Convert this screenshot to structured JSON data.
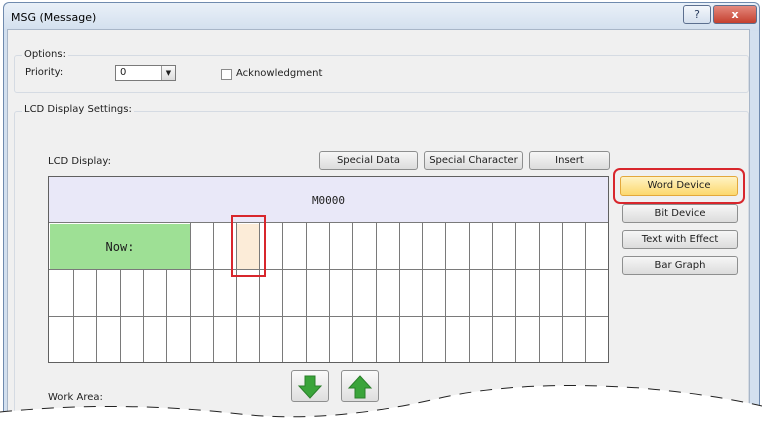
{
  "window": {
    "title": "MSG (Message)",
    "help_glyph": "?",
    "close_glyph": "x"
  },
  "options": {
    "group_label": "Options:",
    "priority_label": "Priority:",
    "priority_value": "0",
    "acknowledgment_label": "Acknowledgment",
    "acknowledgment_checked": false
  },
  "lcd": {
    "group_label": "LCD Display Settings:",
    "display_label": "LCD Display:",
    "row1_device": "M0000",
    "row2_text": "Now:",
    "columns": 24,
    "rows": 4,
    "buttons": {
      "special_data": "Special Data",
      "special_character": "Special Character",
      "insert": "Insert"
    },
    "work_area_label": "Work Area:"
  },
  "side_buttons": {
    "word_device": "Word Device",
    "bit_device": "Bit Device",
    "text_with_effect": "Text with Effect",
    "bar_graph": "Bar Graph"
  },
  "icons": {
    "down": "down-arrow-icon",
    "up": "up-arrow-icon"
  },
  "colors": {
    "highlight": "#d8262c",
    "word_device_bg": "#fcd86e",
    "lcd_header_bg": "#e9e8f8",
    "now_bg": "#9ee095",
    "cursor_bg": "#fcecd8",
    "arrow_green": "#3aa43a"
  }
}
